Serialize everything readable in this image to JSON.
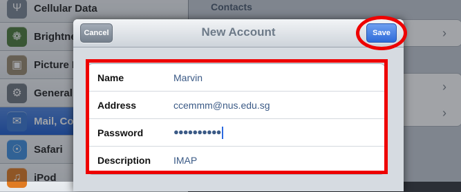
{
  "sidebar": {
    "items": [
      {
        "label": "Cellular Data",
        "icon": "antenna-icon",
        "color": "#7a8794",
        "glyph": "Ψ"
      },
      {
        "label": "Brightness & Wallpaper",
        "icon": "flower-icon",
        "color": "#4d7a3a",
        "glyph": "❁"
      },
      {
        "label": "Picture Frame",
        "icon": "picture-frame-icon",
        "color": "#9a8b6e",
        "glyph": "▣"
      },
      {
        "label": "General",
        "icon": "gear-icon",
        "color": "#6f7780",
        "glyph": "⚙"
      },
      {
        "label": "Mail, Contacts, Calendars",
        "icon": "mail-icon",
        "color": "#3a78d4",
        "glyph": "✉"
      },
      {
        "label": "Safari",
        "icon": "compass-icon",
        "color": "#3f8fe0",
        "glyph": "☉"
      },
      {
        "label": "iPod",
        "icon": "ipod-icon",
        "color": "#e07b22",
        "glyph": "♫"
      }
    ]
  },
  "detail": {
    "section_header": "Contacts"
  },
  "modal": {
    "title": "New Account",
    "cancel_label": "Cancel",
    "save_label": "Save"
  },
  "form": {
    "fields": [
      {
        "label": "Name",
        "value": "Marvin"
      },
      {
        "label": "Address",
        "value": "ccemmm@nus.edu.sg"
      },
      {
        "label": "Password",
        "value": "●●●●●●●●●●"
      },
      {
        "label": "Description",
        "value": "IMAP"
      }
    ]
  },
  "colors": {
    "annotation": "#ee0000",
    "accent": "#2e6bd9"
  }
}
